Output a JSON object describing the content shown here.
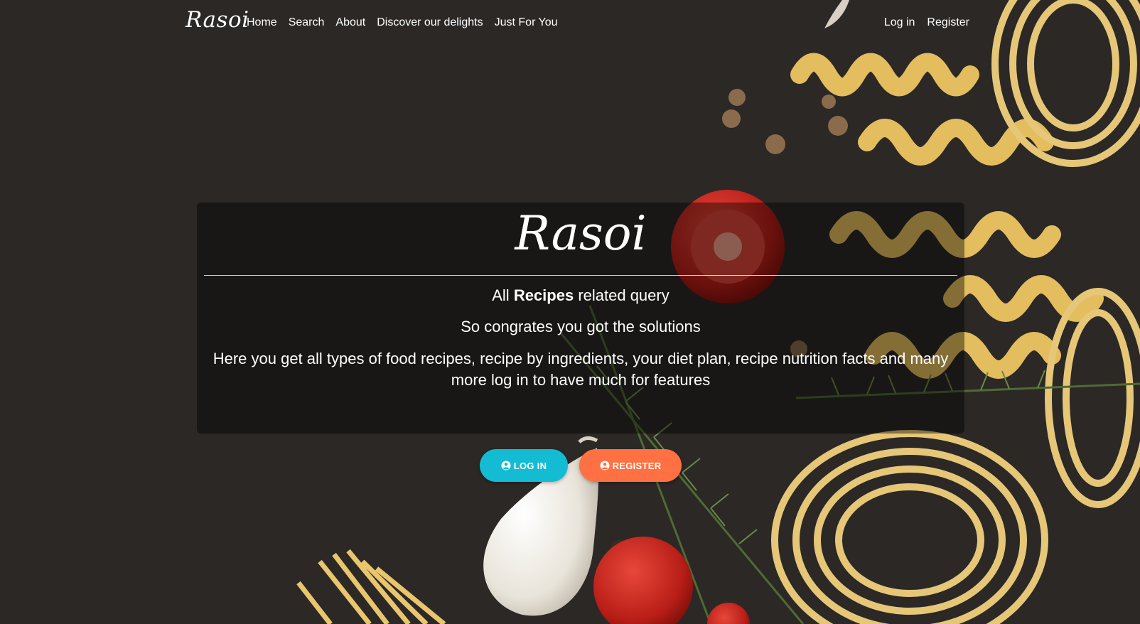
{
  "nav": {
    "brand": "Rasoi",
    "links": [
      "Home",
      "Search",
      "About",
      "Discover our delights",
      "Just For You"
    ],
    "right_links": [
      "Log in",
      "Register"
    ]
  },
  "hero": {
    "title": "Rasoi",
    "line1_prefix": "All ",
    "line1_bold": "Recipes",
    "line1_suffix": " related query",
    "line2": "So congrates you got the solutions",
    "line3": "Here you get all types of food recipes, recipe by ingredients, your diet plan, recipe nutrition facts and many more log in to have much for features"
  },
  "buttons": {
    "login_label": "LOG IN",
    "register_label": "REGISTER",
    "icon": "user-circle-icon"
  },
  "colors": {
    "background": "#2a2725",
    "login_button": "#14bcd3",
    "register_button": "#ff7043",
    "pasta": "#e8c46a",
    "tomato": "#c6281f"
  }
}
